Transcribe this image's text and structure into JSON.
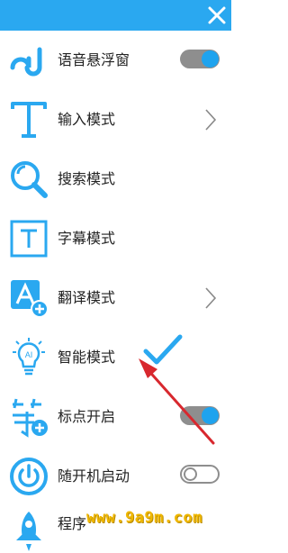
{
  "menu": {
    "items": [
      {
        "label": "语音悬浮窗",
        "icon": "aj-logo-icon",
        "control": "toggle-on"
      },
      {
        "label": "输入模式",
        "icon": "text-t-icon",
        "control": "chevron"
      },
      {
        "label": "搜索模式",
        "icon": "magnifier-icon",
        "control": "none"
      },
      {
        "label": "字幕模式",
        "icon": "subtitle-t-box-icon",
        "control": "none"
      },
      {
        "label": "翻译模式",
        "icon": "translate-icon",
        "control": "chevron"
      },
      {
        "label": "智能模式",
        "icon": "bulb-ai-icon",
        "control": "selected-check"
      },
      {
        "label": "标点开启",
        "icon": "punctuation-add-icon",
        "control": "toggle-on"
      },
      {
        "label": "随开机启动",
        "icon": "power-icon",
        "control": "toggle-off"
      },
      {
        "label": "程序",
        "icon": "rocket-icon",
        "control": "none"
      }
    ]
  },
  "watermark": "www.9a9m.com",
  "colors": {
    "accent": "#2aa8f0",
    "toggle_track": "#8e8e8e",
    "annotation": "#d8282e"
  }
}
